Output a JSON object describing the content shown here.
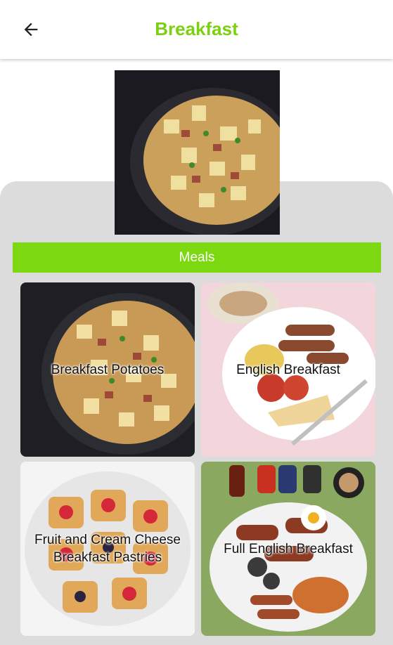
{
  "appbar": {
    "back_icon": "arrow-back-icon",
    "title": "Breakfast"
  },
  "hero": {
    "image": "breakfast-potatoes-skillet-photo"
  },
  "meals": {
    "label": "Meals",
    "items": [
      {
        "label": "Breakfast Potatoes",
        "image": "potatoes-skillet-photo"
      },
      {
        "label": "English Breakfast",
        "image": "english-breakfast-plate-photo"
      },
      {
        "label": "Fruit and Cream Cheese Breakfast Pastries",
        "image": "berry-pastries-photo"
      },
      {
        "label": "Full English Breakfast",
        "image": "full-english-breakfast-photo"
      }
    ]
  },
  "colors": {
    "accent": "#7cd811",
    "title": "#7cd011",
    "panel": "#dcdcdc"
  }
}
